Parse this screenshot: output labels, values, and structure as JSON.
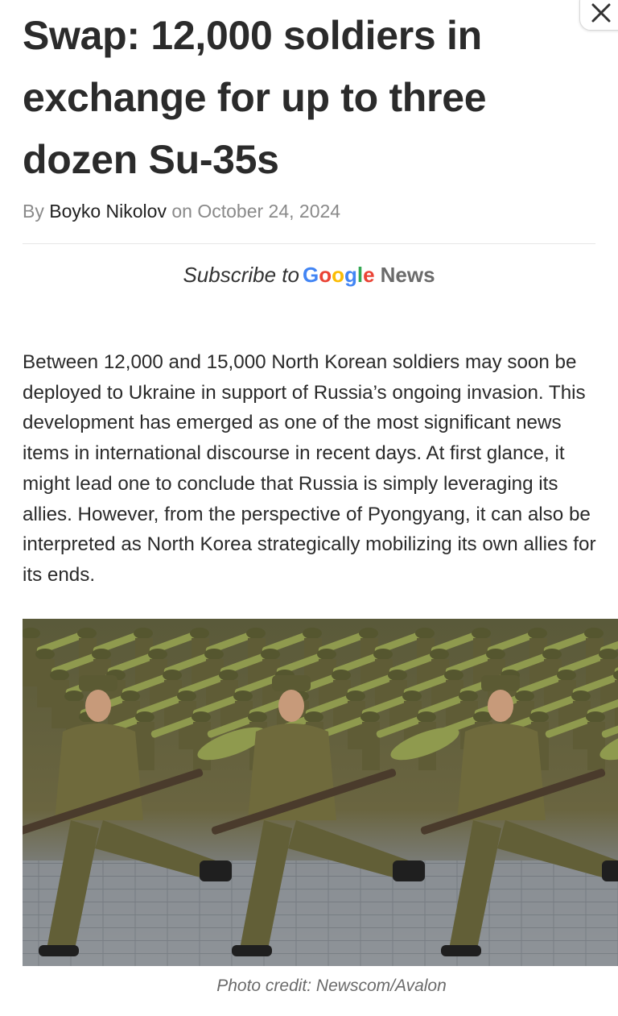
{
  "close_label": "Close",
  "article": {
    "title": "Swap: 12,000 soldiers in exchange for up to three dozen Su-35s",
    "byline": {
      "prefix": "By",
      "author": "Boyko Nikolov",
      "on": "on",
      "date": "October 24, 2024"
    },
    "subscribe": {
      "text": "Subscribe to",
      "google_letters": [
        "G",
        "o",
        "o",
        "g",
        "l",
        "e"
      ],
      "google_colors": [
        "#4285F4",
        "#EA4335",
        "#FBBC05",
        "#4285F4",
        "#34A853",
        "#EA4335"
      ],
      "news": "News"
    },
    "paragraph": "Between 12,000 and 15,000 North Korean soldiers may soon be deployed to Ukraine in support of Russia’s ongoing invasion. This development has emerged as one of the most significant news items in international discourse in recent days. At first glance, it might lead one to conclude that Russia is simply leveraging its allies. However, from the perspective of Pyongyang, it can also be interpreted as North Korea strategically mobilizing its own allies for its ends.",
    "photo_caption": "Photo credit: Newscom/Avalon"
  },
  "colors": {
    "uniform": "#6f6a3c",
    "launcher_tube": "#8f9a4e",
    "pavement": "#8a8f94"
  }
}
